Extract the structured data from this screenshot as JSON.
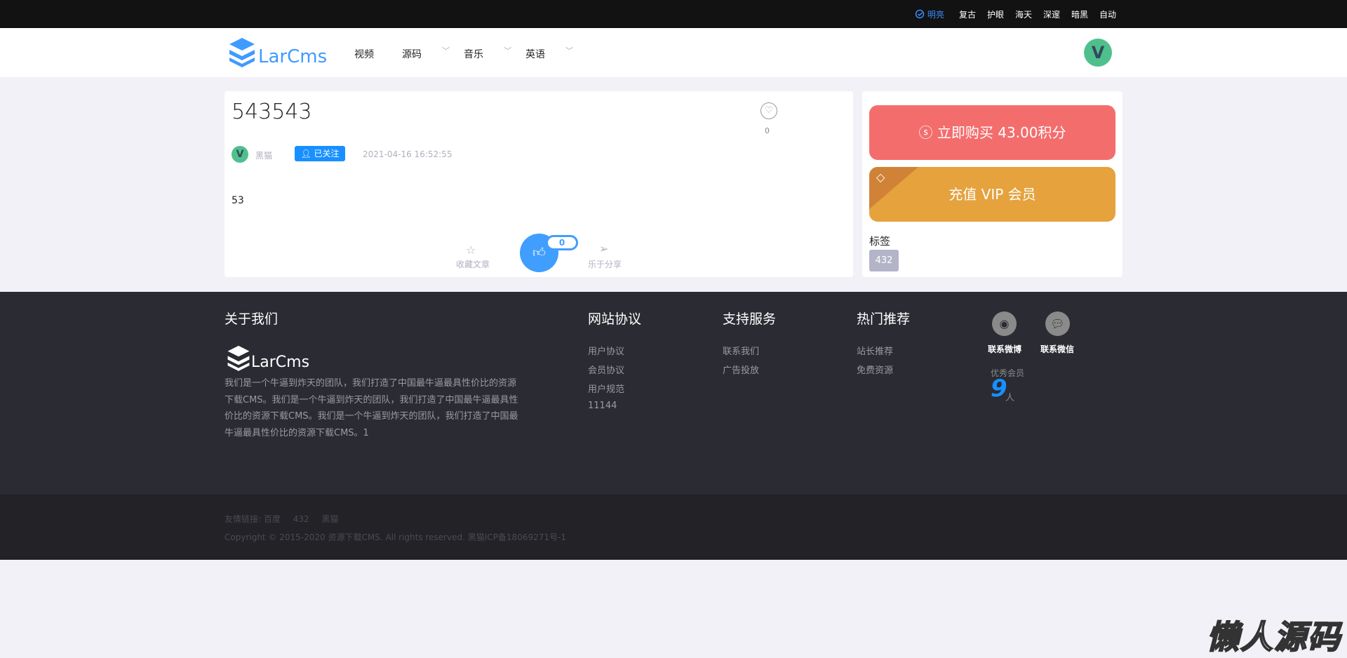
{
  "topbar": {
    "themes": [
      "明亮",
      "复古",
      "护眼",
      "海天",
      "深邃",
      "暗黑",
      "自动"
    ],
    "active_color": "#3b8cff"
  },
  "header": {
    "logo": "LarCms",
    "nav": [
      "视频",
      "源码",
      "音乐",
      "英语"
    ],
    "avatar_letter": "V"
  },
  "article": {
    "title": "543543",
    "favorite_count": "0",
    "author": "黑猫",
    "follow_label": "已关注",
    "date": "2021-04-16 16:52:55",
    "body": "53",
    "collect_label": "收藏文章",
    "like_count": "0",
    "share_label": "乐于分享"
  },
  "sidebar": {
    "buy_label": "立即购买 43.00积分",
    "vip_label": "充值 VIP 会员",
    "tags_title": "标签",
    "tags": [
      "432"
    ]
  },
  "footer": {
    "about_title": "关于我们",
    "logo": "LarCms",
    "about_text": "我们是一个牛逼到炸天的团队，我们打造了中国最牛逼最具性价比的资源下载CMS。我们是一个牛逼到炸天的团队，我们打造了中国最牛逼最具性价比的资源下载CMS。我们是一个牛逼到炸天的团队，我们打造了中国最牛逼最具性价比的资源下载CMS。1",
    "cols": [
      {
        "title": "网站协议",
        "links": [
          "用户协议",
          "会员协议",
          "用户规范",
          "11144"
        ]
      },
      {
        "title": "支持服务",
        "links": [
          "联系我们",
          "广告投放"
        ]
      },
      {
        "title": "热门推荐",
        "links": [
          "站长推荐",
          "免费资源"
        ]
      }
    ],
    "weibo_label": "联系微博",
    "wechat_label": "联系微信",
    "members_label": "优秀会员",
    "members_count": "9",
    "members_unit": "人",
    "friend_links_label": "友情链接:",
    "friend_links": [
      "百度",
      "432",
      "黑猫"
    ],
    "copyright": "Copyright © 2015-2020 资源下载CMS. All rights reserved. 黑猫ICP备18069271号-1"
  },
  "watermark": "懒人源码"
}
